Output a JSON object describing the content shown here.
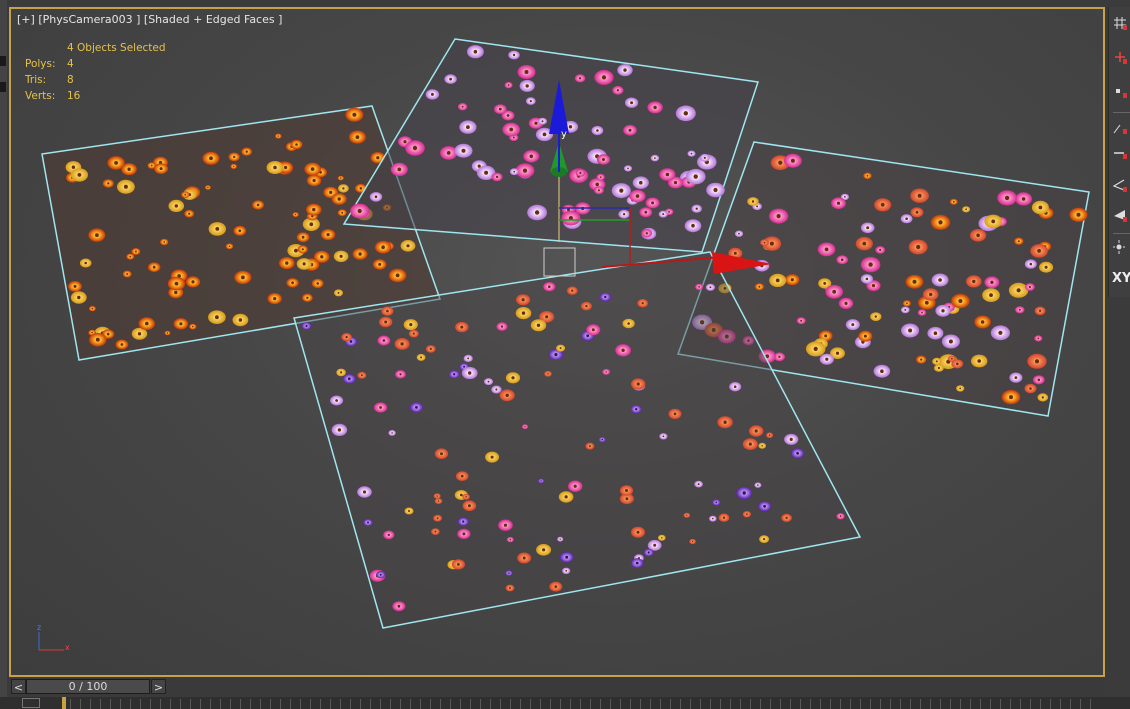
{
  "viewport": {
    "label_plus": "[+]",
    "label_camera": "[PhysCamera003 ]",
    "label_mode": "[Shaded + Edged Faces ]",
    "selected": "4 Objects Selected",
    "stats": [
      {
        "label": "Polys:",
        "value": "4"
      },
      {
        "label": "Tris:",
        "value": "8"
      },
      {
        "label": "Verts:",
        "value": "16"
      }
    ],
    "gizmo_axis": "y",
    "mini_axis": {
      "z": "z",
      "x": "x"
    }
  },
  "toolbar": {
    "tools": [
      "grid-icon",
      "select-move-icon",
      "point-icon",
      "snap-icon",
      "snap-edge-icon",
      "angle-icon",
      "triangle-icon",
      "light-icon"
    ],
    "xy_label": "XY"
  },
  "timeline": {
    "prev": "<",
    "next": ">",
    "frame": "0 / 100"
  },
  "colors": {
    "viewport_border": "#c8a24a",
    "selection_edge": "#9fe6f0",
    "stats_text": "#e6c24a"
  }
}
